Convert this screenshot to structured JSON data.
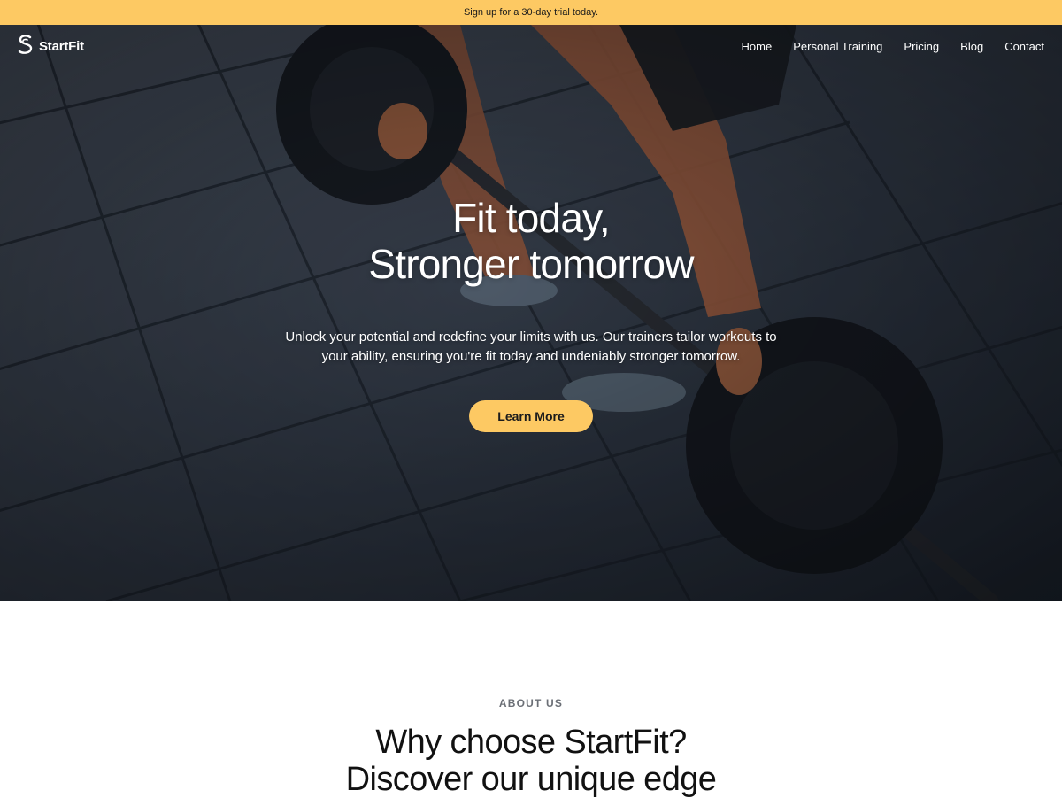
{
  "announcement": {
    "text": "Sign up for a 30-day trial today."
  },
  "brand": {
    "name": "StartFit",
    "logo_icon": "s-logo-icon"
  },
  "nav": {
    "items": [
      {
        "label": "Home"
      },
      {
        "label": "Personal Training"
      },
      {
        "label": "Pricing"
      },
      {
        "label": "Blog"
      },
      {
        "label": "Contact"
      }
    ]
  },
  "hero": {
    "title_line1": "Fit today,",
    "title_line2": "Stronger tomorrow",
    "text": "Unlock your potential and redefine your limits with us. Our trainers tailor workouts to your ability, ensuring you're fit today and undeniably stronger tomorrow.",
    "cta_label": "Learn More",
    "image": "barbell-deadlift-photo"
  },
  "about": {
    "label": "ABOUT US",
    "title_line1": "Why choose StartFit?",
    "title_line2": "Discover our unique edge"
  },
  "colors": {
    "accent": "#fdc963",
    "hero_overlay": "#2b3340",
    "text_dark": "#111111",
    "muted": "#6b6f76"
  }
}
